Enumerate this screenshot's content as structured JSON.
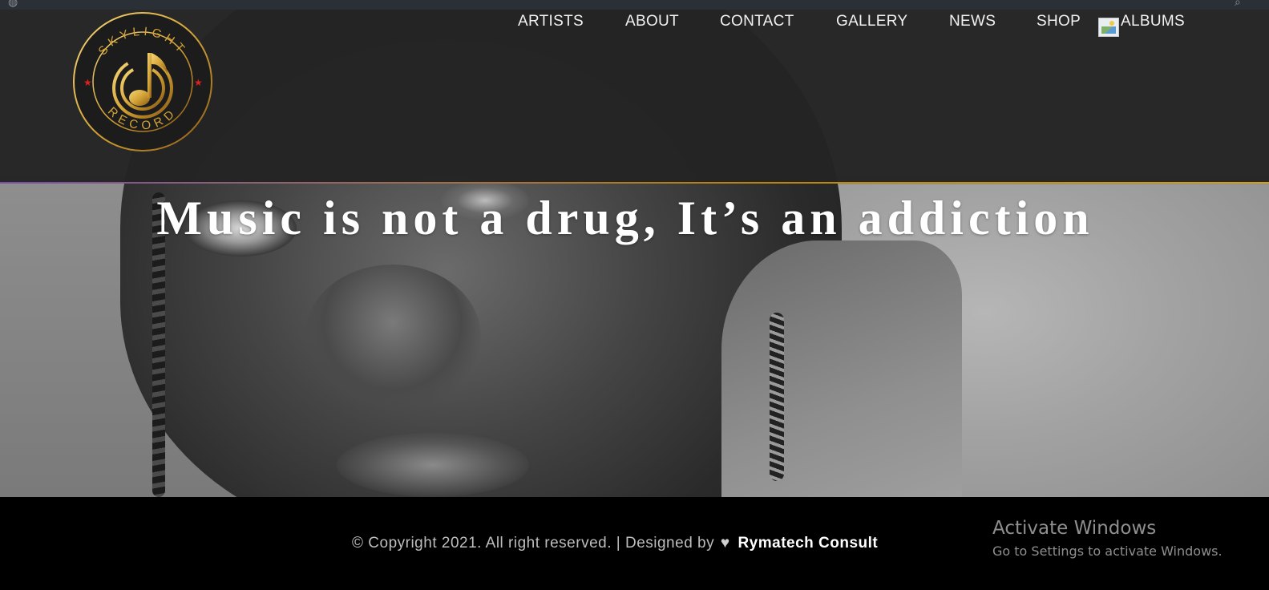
{
  "nav": {
    "items": [
      "ARTISTS",
      "ABOUT",
      "CONTACT",
      "GALLERY",
      "NEWS",
      "SHOP"
    ],
    "albums_label": "ALBUMS"
  },
  "logo": {
    "ring_text_top": "SKYLIGHT",
    "ring_text_bottom": "RECORD",
    "color": "#d4a437"
  },
  "hero": {
    "tagline": "Music is not a drug, It’s an addiction"
  },
  "footer": {
    "copyright": "© Copyright 2021. All right reserved. | Designed by",
    "credit": "Rymatech Consult"
  },
  "watermark": {
    "title": "Activate Windows",
    "subtitle": "Go to Settings to activate Windows."
  },
  "colors": {
    "header_bg": "#242424",
    "accent_gold": "#d4a017",
    "accent_purple": "#7a4ea6"
  }
}
